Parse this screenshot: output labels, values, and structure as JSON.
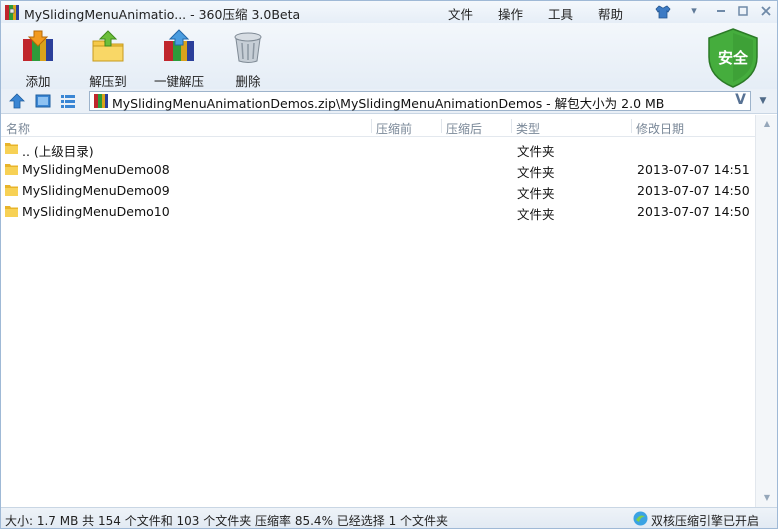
{
  "window": {
    "title": "MySlidingMenuAnimatio... - 360压缩 3.0Beta",
    "menus": [
      "文件",
      "操作",
      "工具",
      "帮助"
    ]
  },
  "toolbar": {
    "buttons": [
      {
        "label": "添加",
        "icon": "add-archive-icon"
      },
      {
        "label": "解压到",
        "icon": "extract-to-icon"
      },
      {
        "label": "一键解压",
        "icon": "one-click-extract-icon"
      },
      {
        "label": "删除",
        "icon": "trash-icon"
      }
    ],
    "security_label": "安全"
  },
  "address": {
    "path": "MySlidingMenuAnimationDemos.zip\\MySlidingMenuAnimationDemos - 解包大小为 2.0 MB",
    "v_badge": "V"
  },
  "columns": [
    "名称",
    "压缩前",
    "压缩后",
    "类型",
    "修改日期"
  ],
  "rows": [
    {
      "name": ".. (上级目录)",
      "type": "文件夹",
      "date": ""
    },
    {
      "name": "MySlidingMenuDemo08",
      "type": "文件夹",
      "date": "2013-07-07 14:51"
    },
    {
      "name": "MySlidingMenuDemo09",
      "type": "文件夹",
      "date": "2013-07-07 14:50"
    },
    {
      "name": "MySlidingMenuDemo10",
      "type": "文件夹",
      "date": "2013-07-07 14:50"
    }
  ],
  "status": {
    "summary": "大小: 1.7 MB 共 154 个文件和 103 个文件夹 压缩率 85.4% 已经选择 1 个文件夹",
    "engine": "双核压缩引擎已开启"
  },
  "colors": {
    "accent": "#2f6fb7",
    "folder": "#f2c53d",
    "shield": "#3fa43a"
  }
}
